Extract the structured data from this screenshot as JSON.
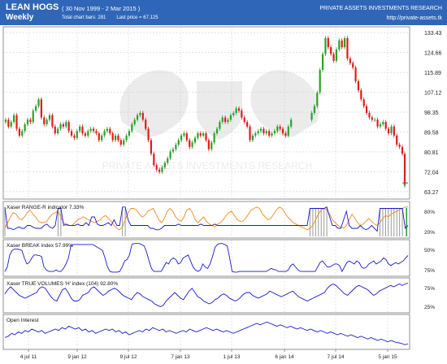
{
  "header": {
    "symbol": "LEAN HOGS",
    "period": "Weekly",
    "date_range": "( 30 Nov 1999 - 2 Mar 2015 )",
    "total_bars": "Total chart bars: 281",
    "last_price": "Last price = 67.125",
    "organization": "PRIVATE ASSETS INVESTMENTS RESEARCH",
    "url": "http://private-assets.tk"
  },
  "watermark": "PRIVATE ASSETS INVESTMENTS RESEARCH",
  "colors": {
    "header": "#2f66b8",
    "up": "#2aa12a",
    "down": "#e11b1b",
    "indicator": "#1a1acc",
    "orange": "#f08c1e",
    "grid": "#c8c8c8"
  },
  "x_axis": {
    "labels": [
      "4 jul 11",
      "9 jan 12",
      "9 jul 12",
      "7 jan 13",
      "1 jul 13",
      "6 jan 14",
      "7 jul 14",
      "5 jan 15"
    ]
  },
  "chart_data": [
    {
      "name": "price",
      "type": "candlestick",
      "ylim": [
        60,
        136
      ],
      "y_ticks": [
        "133.43",
        "124.66",
        "115.89",
        "107.12",
        "98.35",
        "89.58",
        "80.81",
        "72.04",
        "63.27"
      ],
      "closes": [
        95,
        92,
        94,
        97,
        91,
        88,
        90,
        93,
        95,
        94,
        99,
        101,
        104,
        96,
        93,
        95,
        97,
        92,
        89,
        91,
        93,
        92,
        94,
        90,
        88,
        87,
        90,
        92,
        89,
        88,
        90,
        91,
        90,
        89,
        86,
        88,
        90,
        91,
        89,
        86,
        88,
        86,
        84,
        86,
        88,
        90,
        93,
        95,
        97,
        98,
        95,
        91,
        86,
        80,
        75,
        73,
        72,
        74,
        76,
        78,
        81,
        82,
        84,
        86,
        88,
        89,
        86,
        83,
        85,
        87,
        89,
        88,
        89,
        86,
        82,
        85,
        89,
        91,
        94,
        96,
        94,
        95,
        97,
        98,
        100,
        99,
        96,
        94,
        92,
        86,
        88,
        89,
        90,
        91,
        89,
        90,
        88,
        89,
        90,
        92,
        91,
        89,
        88,
        92,
        95,
        98,
        101,
        107,
        117,
        124,
        131,
        127,
        124,
        121,
        126,
        130,
        127,
        131,
        122,
        120,
        118,
        112,
        108,
        104,
        101,
        98,
        96,
        95,
        95,
        92,
        93,
        94,
        91,
        89,
        92,
        88,
        84,
        83,
        80,
        79,
        78,
        74,
        72,
        70,
        68,
        66,
        67
      ],
      "last": 67.125
    },
    {
      "name": "Xaser RANGE-R indicator",
      "label": "Xaser RANGE-R indicator  7.33%",
      "type": "line",
      "y_ticks": [
        "80%",
        "20%"
      ],
      "series": [
        {
          "values": [
            0.95,
            0.2,
            0.2,
            0.15,
            0.2,
            0.25,
            0.2,
            0.2,
            0.3,
            0.3,
            0.25,
            0.2,
            0.2,
            0.2,
            0.3,
            0.35,
            0.25,
            0.2,
            0.3,
            0.9,
            0.9,
            0.3,
            0.35,
            0.3,
            0.3,
            0.3,
            0.35,
            0.3,
            0.3,
            0.4,
            0.3,
            0.6,
            0.6,
            0.35,
            0.3,
            0.3,
            0.35,
            0.4,
            0.3,
            0.5,
            0.3,
            0.3,
            0.95,
            0.95,
            0.5,
            0.3,
            0.3,
            0.3,
            0.3,
            0.3,
            0.3,
            0.3,
            0.2,
            0.2,
            0.15,
            0.15,
            0.2,
            0.3,
            0.3,
            0.3,
            0.3,
            0.3,
            0.35,
            0.3,
            0.3,
            0.3,
            0.3,
            0.3,
            0.3,
            0.3,
            0.35,
            0.3,
            0.3,
            0.3,
            0.3,
            0.35,
            0.3,
            0.3,
            0.3,
            0.3,
            0.3,
            0.3,
            0.3,
            0.3,
            0.3,
            0.3,
            0.3,
            0.3,
            0.3,
            0.3,
            0.3,
            0.3,
            0.3,
            0.3,
            0.3,
            0.3,
            0.3,
            0.3,
            0.3,
            0.3,
            0.3,
            0.3,
            0.3,
            0.3,
            0.3,
            0.3,
            0.3,
            0.3,
            0.3,
            0.9,
            0.9,
            0.9,
            0.9,
            0.9,
            0.9,
            0.95,
            0.6,
            0.3,
            0.3,
            0.2,
            0.2,
            0.5,
            0.8,
            0.3,
            0.2,
            0.2,
            0.2,
            0.3,
            0.2,
            0.15,
            0.2,
            0.3,
            0.2,
            0.1,
            0.9,
            0.9,
            0.9,
            0.9,
            0.9,
            0.9,
            0.9,
            0.9,
            0.9,
            0.2,
            0.3
          ]
        },
        {
          "values": [
            0.2,
            0.4,
            0.6,
            0.75,
            0.7,
            0.55,
            0.5,
            0.6,
            0.75,
            0.85,
            0.7,
            0.6,
            0.45,
            0.4,
            0.4,
            0.45,
            0.6,
            0.7,
            0.75,
            0.8,
            0.6,
            0.4,
            0.3,
            0.3,
            0.3,
            0.4,
            0.5,
            0.55,
            0.6,
            0.55,
            0.5,
            0.45,
            0.4,
            0.45,
            0.5,
            0.6,
            0.65,
            0.55,
            0.45,
            0.3,
            0.2,
            0.15,
            0.25,
            0.5,
            0.75,
            0.9,
            0.9,
            0.85,
            0.7,
            0.6,
            0.65,
            0.8,
            0.85,
            0.9,
            0.7,
            0.5,
            0.4,
            0.55,
            0.8,
            0.9,
            0.8,
            0.6,
            0.5,
            0.45,
            0.6,
            0.85,
            0.9,
            0.75,
            0.5,
            0.4,
            0.5,
            0.6,
            0.45,
            0.35,
            0.3,
            0.25,
            0.35,
            0.4,
            0.5,
            0.65,
            0.75,
            0.8,
            0.65,
            0.5,
            0.45,
            0.45,
            0.55,
            0.7,
            0.85,
            0.9,
            0.95,
            0.9,
            0.7,
            0.6,
            0.5,
            0.55,
            0.7,
            0.85,
            0.95,
            0.9,
            0.75,
            0.6,
            0.5,
            0.4,
            0.35,
            0.3,
            0.25,
            0.2,
            0.15,
            0.2,
            0.3,
            0.5,
            0.7,
            0.85,
            0.9,
            0.85,
            0.7,
            0.5,
            0.4,
            0.3,
            0.25,
            0.2,
            0.3,
            0.5,
            0.7,
            0.55,
            0.4,
            0.3,
            0.35,
            0.45,
            0.55,
            0.45,
            0.35,
            0.3,
            0.4,
            0.55,
            0.65,
            0.6,
            0.7,
            0.75,
            0.8,
            0.85,
            0.9,
            0.95,
            0.95
          ]
        }
      ]
    },
    {
      "name": "Xaser BREAK index",
      "label": "Xaser BREAK index  57.99%",
      "type": "line",
      "y_ticks": [
        "50%",
        "75%"
      ],
      "series": [
        {
          "values": [
            0.05,
            0.2,
            0.6,
            0.75,
            0.8,
            0.8,
            0.78,
            0.75,
            0.5,
            0.3,
            0.35,
            0.5,
            0.6,
            0.6,
            0.58,
            0.55,
            0.2,
            0.1,
            0.05,
            0.05,
            0.05,
            0.1,
            0.05,
            0.05,
            0.15,
            0.3,
            0.5,
            0.9,
            0.95,
            0.95,
            0.95,
            0.95,
            0.95,
            0.95,
            0.95,
            0.95,
            0.95,
            0.9,
            0.85,
            0.8,
            0.75,
            0.5,
            0.2,
            0.05,
            0.03,
            0.03,
            0.03,
            0.05,
            0.2,
            0.4,
            0.45,
            0.6,
            0.95,
            0.98,
            0.98,
            0.98,
            0.95,
            0.9,
            0.7,
            0.4,
            0.15,
            0.05,
            0.05,
            0.05,
            0.05,
            0.2,
            0.35,
            0.3,
            0.45,
            0.5,
            0.45,
            0.3,
            0.35,
            0.5,
            0.55,
            0.6,
            0.4,
            0.2,
            0.1,
            0.05,
            0.1,
            0.3,
            0.2,
            0.15,
            0.3,
            0.55,
            0.85,
            0.95,
            0.98,
            0.98,
            0.95,
            0.9,
            0.5,
            0.05,
            0.03,
            0.03,
            0.05,
            0.05,
            0.05,
            0.05,
            0.05,
            0.05,
            0.05,
            0.05,
            0.05,
            0.05,
            0.05,
            0.05,
            0.1,
            0.15,
            0.12,
            0.1,
            0.05,
            0.05,
            0.05,
            0.05,
            0.1,
            0.25,
            0.3,
            0.2,
            0.1,
            0.05,
            0.05,
            0.05,
            0.05,
            0.05,
            0.05,
            0.05,
            0.2,
            0.35,
            0.4,
            0.3,
            0.2,
            0.2,
            0.25,
            0.3,
            0.3,
            0.25,
            0.05,
            0.2,
            0.35,
            0.4,
            0.35,
            0.3,
            0.4,
            0.35,
            0.2,
            0.15,
            0.2,
            0.3,
            0.35,
            0.4,
            0.3,
            0.35,
            0.4,
            0.5,
            0.45,
            0.3,
            0.25,
            0.3,
            0.35,
            0.3,
            0.35,
            0.4,
            0.5,
            0.58
          ]
        }
      ]
    },
    {
      "name": "Xaser TRUE VOLUMES 'H' index",
      "label": "Xaser TRUE VOLUMES 'H' index (104)  92.80%",
      "type": "line",
      "y_ticks": [
        "75%",
        "25%"
      ],
      "series": [
        {
          "values": [
            0.55,
            0.7,
            0.8,
            0.7,
            0.6,
            0.5,
            0.45,
            0.4,
            0.45,
            0.5,
            0.55,
            0.6,
            0.75,
            0.8,
            0.75,
            0.6,
            0.45,
            0.35,
            0.3,
            0.5,
            0.7,
            0.75,
            0.6,
            0.4,
            0.3,
            0.3,
            0.35,
            0.5,
            0.55,
            0.6,
            0.75,
            0.8,
            0.7,
            0.6,
            0.5,
            0.55,
            0.65,
            0.7,
            0.75,
            0.7,
            0.6,
            0.5,
            0.45,
            0.4,
            0.35,
            0.5,
            0.6,
            0.55,
            0.45,
            0.4,
            0.35,
            0.3,
            0.2,
            0.15,
            0.1,
            0.15,
            0.3,
            0.4,
            0.5,
            0.6,
            0.5,
            0.4,
            0.35,
            0.5,
            0.65,
            0.75,
            0.6,
            0.45,
            0.4,
            0.3,
            0.25,
            0.2,
            0.25,
            0.35,
            0.4,
            0.5,
            0.55,
            0.5,
            0.4,
            0.35,
            0.3,
            0.35,
            0.45,
            0.55,
            0.6,
            0.6,
            0.5,
            0.45,
            0.4,
            0.45,
            0.5,
            0.55,
            0.65,
            0.6,
            0.55,
            0.5,
            0.45,
            0.5,
            0.55,
            0.6,
            0.65,
            0.55,
            0.45,
            0.4,
            0.35,
            0.3,
            0.35,
            0.4,
            0.45,
            0.5,
            0.55,
            0.6,
            0.75,
            0.85,
            0.9,
            0.85,
            0.75,
            0.65,
            0.55,
            0.5,
            0.6,
            0.7,
            0.8,
            0.85,
            0.8,
            0.75,
            0.7,
            0.6,
            0.5,
            0.55,
            0.65,
            0.7,
            0.75,
            0.8,
            0.85,
            0.8,
            0.85,
            0.9,
            0.85,
            0.9,
            0.93
          ]
        }
      ]
    },
    {
      "name": "Open Interest",
      "label": "Open Interest",
      "type": "line",
      "series": [
        {
          "values": [
            0.3,
            0.35,
            0.45,
            0.4,
            0.5,
            0.45,
            0.55,
            0.5,
            0.6,
            0.55,
            0.5,
            0.55,
            0.45,
            0.5,
            0.55,
            0.6,
            0.55,
            0.65,
            0.6,
            0.7,
            0.65,
            0.6,
            0.65,
            0.55,
            0.6,
            0.5,
            0.55,
            0.45,
            0.5,
            0.55,
            0.6,
            0.55,
            0.6,
            0.5,
            0.55,
            0.45,
            0.5,
            0.4,
            0.45,
            0.5,
            0.55,
            0.5,
            0.6,
            0.55,
            0.65,
            0.6,
            0.55,
            0.6,
            0.5,
            0.55,
            0.5,
            0.45,
            0.5,
            0.55,
            0.5,
            0.6,
            0.55,
            0.5,
            0.55,
            0.6,
            0.65,
            0.6,
            0.55,
            0.6,
            0.55,
            0.5,
            0.55,
            0.5,
            0.45,
            0.5,
            0.55,
            0.6,
            0.65,
            0.7,
            0.75,
            0.8,
            0.75,
            0.8,
            0.85,
            0.8,
            0.75,
            0.7,
            0.75,
            0.7,
            0.65,
            0.7,
            0.65,
            0.6,
            0.65,
            0.6,
            0.55,
            0.6,
            0.55,
            0.5,
            0.55,
            0.5,
            0.45,
            0.5,
            0.45,
            0.4,
            0.45,
            0.4,
            0.35,
            0.4,
            0.35,
            0.3,
            0.35,
            0.3,
            0.25,
            0.3,
            0.25,
            0.2,
            0.25,
            0.2,
            0.15,
            0.2,
            0.15,
            0.12,
            0.1,
            0.05,
            0.08
          ]
        }
      ]
    }
  ]
}
